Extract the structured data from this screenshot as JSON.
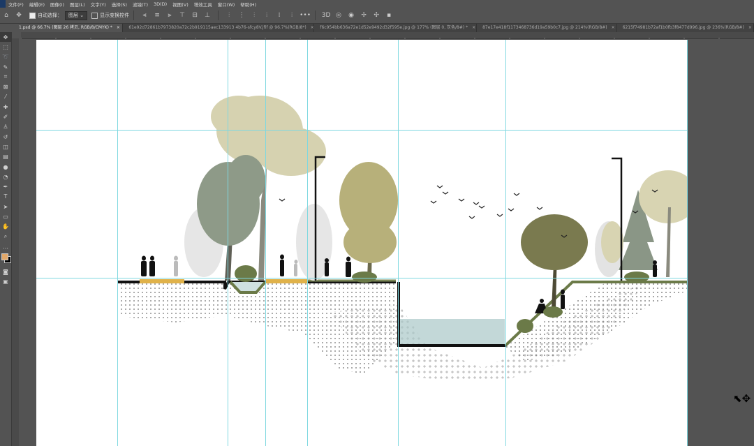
{
  "menubar": {
    "items": [
      "文件(F)",
      "编辑(E)",
      "图像(I)",
      "图层(L)",
      "文字(Y)",
      "选择(S)",
      "滤镜(T)",
      "3D(D)",
      "视图(V)",
      "增效工具",
      "窗口(W)",
      "帮助(H)"
    ]
  },
  "options": {
    "auto_select_label": "自动选择：",
    "auto_select_value": "图层",
    "show_transform_label": "显示变换控件",
    "more": "•••"
  },
  "tabs": [
    {
      "label": "1.psd @ 66.7% (图层 26 拷贝, RGB/8/CMYK) *",
      "close": "×",
      "active": true
    },
    {
      "label": "61e92d72861b7973820a72c2b919115aec133913 4b76-sfcy8V.jfif @ 96.7%(RGB/8*)",
      "close": "×",
      "active": false
    },
    {
      "label": "f6c954bb636a72e1d52e9492d32f595e.jpg @ 177% (图层 0, 灰色/8#) *",
      "close": "×",
      "active": false
    },
    {
      "label": "87e17e418f1173468736d19a59b0c7.jpg @ 214%(RGB/8#)",
      "close": "×",
      "active": false
    },
    {
      "label": "6215f74981b72af1b0fb3f8477d996.jpg @ 236%(RGB/8#)",
      "close": "×",
      "active": false
    }
  ],
  "tools": [
    "move-tool",
    "marquee-tool",
    "lasso-tool",
    "quick-select-tool",
    "crop-tool",
    "frame-tool",
    "eyedropper-tool",
    "healing-brush-tool",
    "brush-tool",
    "clone-stamp-tool",
    "history-brush-tool",
    "eraser-tool",
    "gradient-tool",
    "blur-tool",
    "dodge-tool",
    "pen-tool",
    "type-tool",
    "path-select-tool",
    "rectangle-tool",
    "hand-tool",
    "zoom-tool",
    "edit-toolbar"
  ],
  "colors": {
    "foreground": "#e2a86a",
    "background": "#000000",
    "guide": "#7fd8e0"
  }
}
